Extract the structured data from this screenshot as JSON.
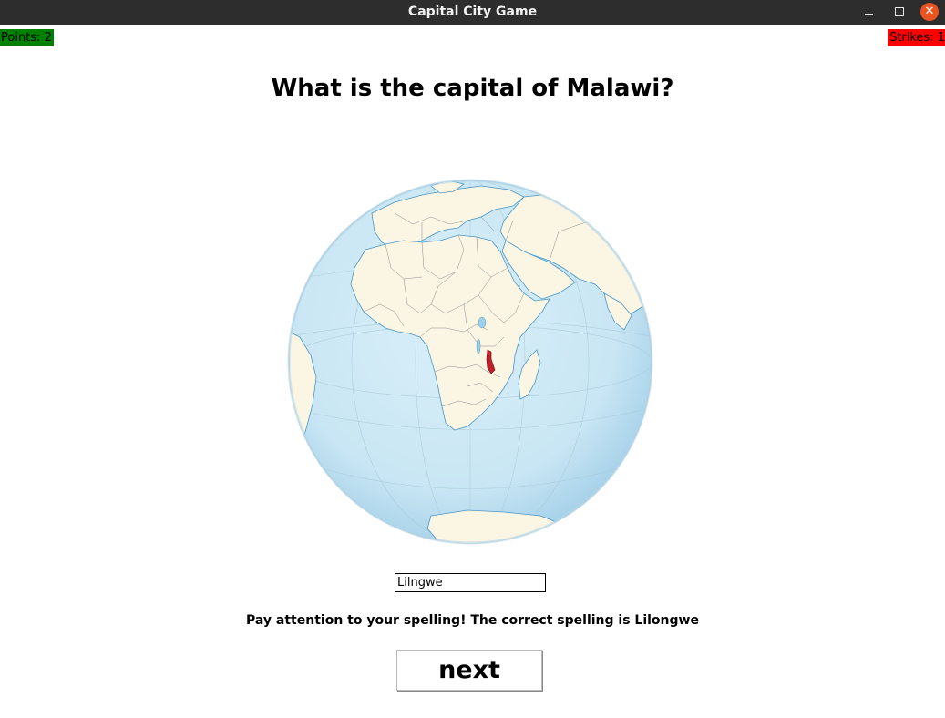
{
  "window": {
    "title": "Capital City Game",
    "minimize_symbol": "–",
    "close_symbol": "✕"
  },
  "status": {
    "points": "Points: 2",
    "strikes": "Strikes: 1"
  },
  "question": "What is the capital of Malawi?",
  "map": {
    "subject": "orthographic globe centered on Africa",
    "highlighted_country": "Malawi",
    "colors": {
      "ocean": "#cfe9f6",
      "land": "#fbf6e4",
      "border": "#8a8a8a",
      "coast": "#3f8fbf",
      "highlight": "#c0202a"
    }
  },
  "answer": {
    "value": "Lilngwe"
  },
  "feedback": "Pay attention to your spelling! The correct spelling is Lilongwe",
  "next_button": {
    "label": "next"
  },
  "colors": {
    "points_bg": "#008000",
    "strikes_bg": "#ff0000",
    "titlebar_bg": "#2d2d2d",
    "close_btn": "#e95420"
  }
}
